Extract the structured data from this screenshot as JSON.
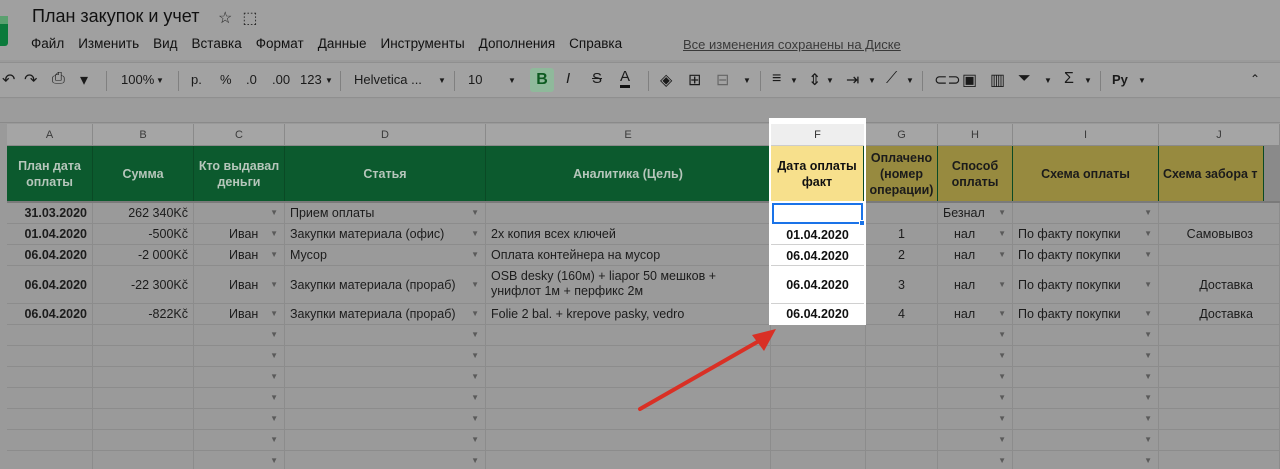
{
  "document": {
    "title": "План закупок и учет",
    "saved_status": "Все изменения сохранены на Диске"
  },
  "menu": [
    "Файл",
    "Изменить",
    "Вид",
    "Вставка",
    "Формат",
    "Данные",
    "Инструменты",
    "Дополнения",
    "Справка"
  ],
  "toolbar": {
    "zoom": "100%",
    "currency": "р.",
    "percent": "%",
    "dec_less": ".0",
    "dec_more": ".00",
    "more_formats": "123",
    "font": "Helvetica ...",
    "font_size": "10",
    "bold": "B",
    "italic": "I",
    "strike": "S",
    "text_color": "A",
    "input_tools": "Py"
  },
  "columns": [
    "A",
    "B",
    "C",
    "D",
    "E",
    "F",
    "G",
    "H",
    "I",
    "J"
  ],
  "headers": [
    "План дата оплаты",
    "Сумма",
    "Кто выдавал деньги",
    "Статья",
    "Аналитика (Цель)",
    "Дата оплаты факт",
    "Оплачено (номер операции)",
    "Способ оплаты",
    "Схема оплаты",
    "Схема забора т"
  ],
  "rows": [
    {
      "a": "31.03.2020",
      "b": "262 340Kč",
      "c": "",
      "d": "Прием оплаты",
      "e": "",
      "f": "",
      "g": "",
      "h": "Безнал",
      "i": "",
      "j": ""
    },
    {
      "a": "01.04.2020",
      "b": "-500Kč",
      "c": "Иван",
      "d": "Закупки материала (офис)",
      "e": "2x копия всех ключей",
      "f": "01.04.2020",
      "g": "1",
      "h": "нал",
      "i": "По факту покупки",
      "j": "Самовывоз"
    },
    {
      "a": "06.04.2020",
      "b": "-2 000Kč",
      "c": "Иван",
      "d": "Мусор",
      "e": "Оплата контейнера на мусор",
      "f": "06.04.2020",
      "g": "2",
      "h": "нал",
      "i": "По факту покупки",
      "j": ""
    },
    {
      "a": "06.04.2020",
      "b": "-22 300Kč",
      "c": "Иван",
      "d": "Закупки материала (прораб)",
      "e": "OSB desky (160м) + liapor 50 мешков + унифлот 1м + перфикс 2м",
      "f": "06.04.2020",
      "g": "3",
      "h": "нал",
      "i": "По факту покупки",
      "j": "Доставка"
    },
    {
      "a": "06.04.2020",
      "b": "-822Kč",
      "c": "Иван",
      "d": "Закупки материала (прораб)",
      "e": "Folie 2 bal. + krepove pasky, vedro",
      "f": "06.04.2020",
      "g": "4",
      "h": "нал",
      "i": "По факту покупки",
      "j": "Доставка"
    }
  ],
  "colors": {
    "header_green": "#0c5a2e",
    "header_gold": "#978a3f",
    "highlight_yellow": "#f7e08c",
    "selection_blue": "#1a73e8",
    "arrow_red": "#d93025"
  }
}
